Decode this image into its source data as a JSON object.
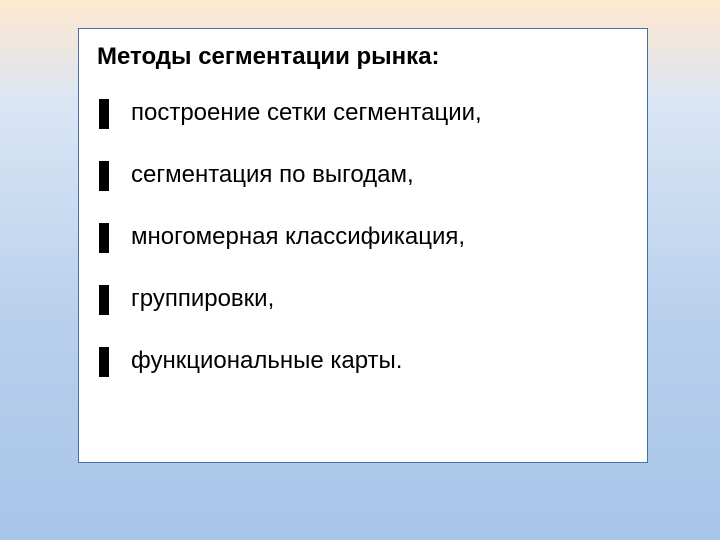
{
  "title": "Методы сегментации рынка:",
  "items": [
    "построение сетки сегментации,",
    "сегментация по выгодам,",
    "многомерная классификация,",
    "группировки,",
    "функциональные карты."
  ]
}
